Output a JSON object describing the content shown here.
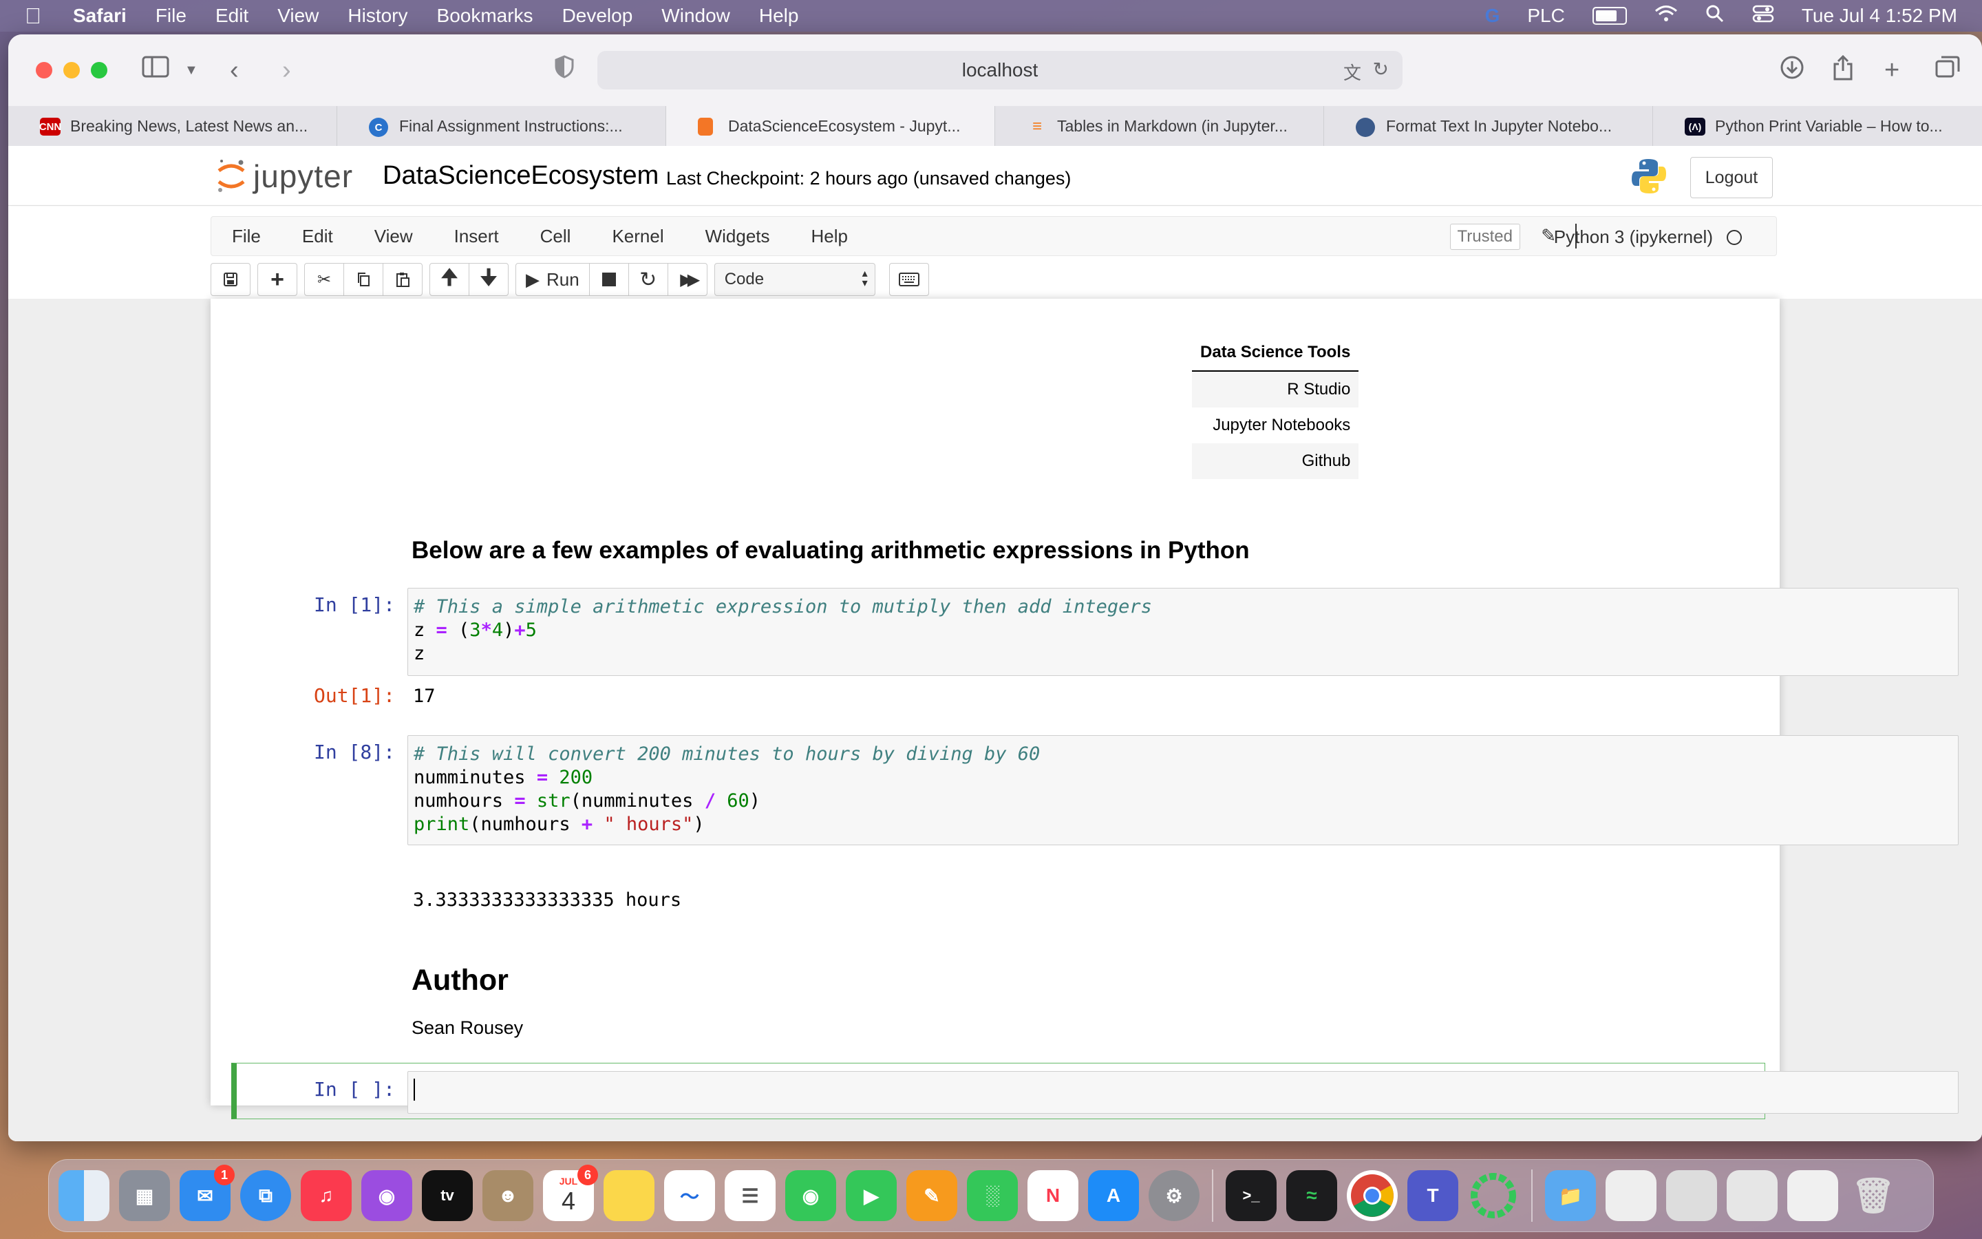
{
  "menubar": {
    "app": "Safari",
    "items": [
      "File",
      "Edit",
      "View",
      "History",
      "Bookmarks",
      "Develop",
      "Window",
      "Help"
    ],
    "status_text": "PLC",
    "datetime": "Tue Jul 4  1:52 PM"
  },
  "browser": {
    "url": "localhost",
    "tabs": [
      {
        "label": "Breaking News, Latest News an...",
        "icon": "cnn-favicon",
        "active": false
      },
      {
        "label": "Final Assignment Instructions:...",
        "icon": "coursera-favicon",
        "active": false
      },
      {
        "label": "DataScienceEcosystem - Jupyt...",
        "icon": "jupyter-favicon",
        "active": true
      },
      {
        "label": "Tables in Markdown (in Jupyter...",
        "icon": "stackoverflow-favicon",
        "active": false
      },
      {
        "label": "Format Text In Jupyter Notebo...",
        "icon": "globe-favicon",
        "active": false
      },
      {
        "label": "Python Print Variable – How to...",
        "icon": "freecodecamp-favicon",
        "active": false
      }
    ]
  },
  "jupyter": {
    "logo_text": "jupyter",
    "notebook_name": "DataScienceEcosystem",
    "checkpoint": "Last Checkpoint: 2 hours ago   (unsaved changes)",
    "logout_label": "Logout",
    "menu": [
      "File",
      "Edit",
      "View",
      "Insert",
      "Cell",
      "Kernel",
      "Widgets",
      "Help"
    ],
    "trusted_label": "Trusted",
    "kernel_name": "Python 3 (ipykernel)",
    "run_label": "Run",
    "cell_type": "Code"
  },
  "notebook": {
    "table": {
      "header": "Data Science Tools",
      "rows": [
        "R Studio",
        "Jupyter Notebooks",
        "Github"
      ]
    },
    "section_heading": "Below are a few examples of evaluating arithmetic expressions in Python",
    "cell1": {
      "prompt_in": "In [1]:",
      "prompt_out": "Out[1]:",
      "comment": "# This a simple arithmetic expression to mutiply then add integers",
      "output": "17"
    },
    "cell2": {
      "prompt_in": "In [8]:",
      "comment": "# This will convert 200 minutes to hours by diving by 60",
      "output": "3.3333333333333335 hours"
    },
    "author_heading": "Author",
    "author_name": "Sean Rousey",
    "empty_prompt": "In [ ]:"
  },
  "dock": {
    "mail_badge": "1",
    "calendar_badge": "6",
    "calendar_month": "JUL",
    "calendar_day": "4"
  }
}
